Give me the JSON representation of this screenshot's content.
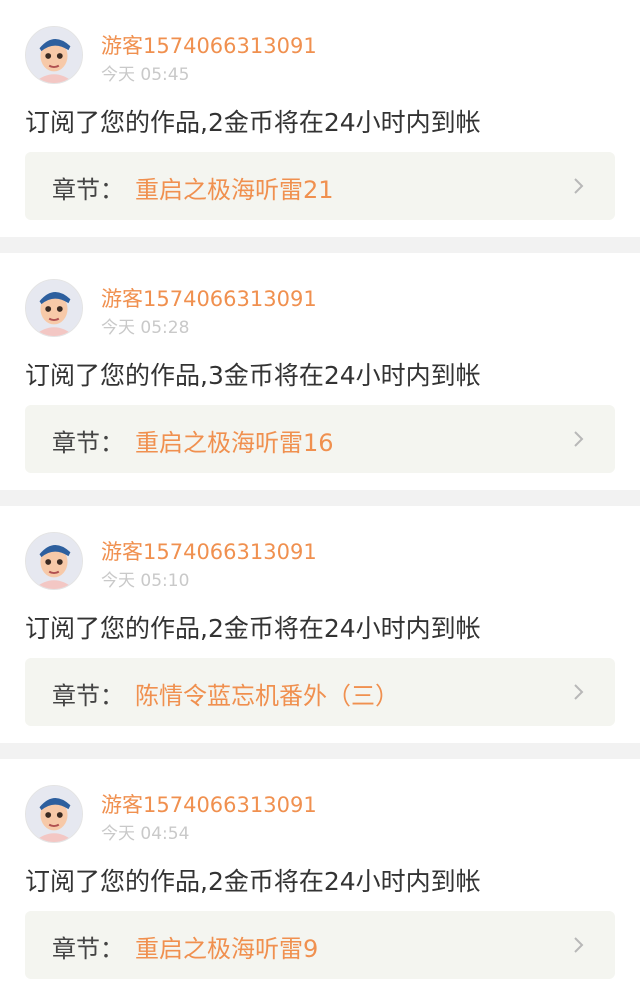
{
  "notifications": [
    {
      "username": "游客1574066313091",
      "time": "今天 05:45",
      "message": "订阅了您的作品,2金币将在24小时内到帐",
      "chapter_prefix": "章节：",
      "chapter_title": "重启之极海听雷21"
    },
    {
      "username": "游客1574066313091",
      "time": "今天 05:28",
      "message": "订阅了您的作品,3金币将在24小时内到帐",
      "chapter_prefix": "章节：",
      "chapter_title": "重启之极海听雷16"
    },
    {
      "username": "游客1574066313091",
      "time": "今天 05:10",
      "message": "订阅了您的作品,2金币将在24小时内到帐",
      "chapter_prefix": "章节：",
      "chapter_title": "陈情令蓝忘机番外（三）"
    },
    {
      "username": "游客1574066313091",
      "time": "今天 04:54",
      "message": "订阅了您的作品,2金币将在24小时内到帐",
      "chapter_prefix": "章节：",
      "chapter_title": "重启之极海听雷9"
    }
  ],
  "icons": {
    "avatar": "cartoon-boy-avatar",
    "chevron": "chevron-right-icon"
  },
  "colors": {
    "accent": "#f0904f",
    "text": "#333333",
    "muted": "#c9c9c9",
    "chapter_bg": "#f4f5f0"
  }
}
